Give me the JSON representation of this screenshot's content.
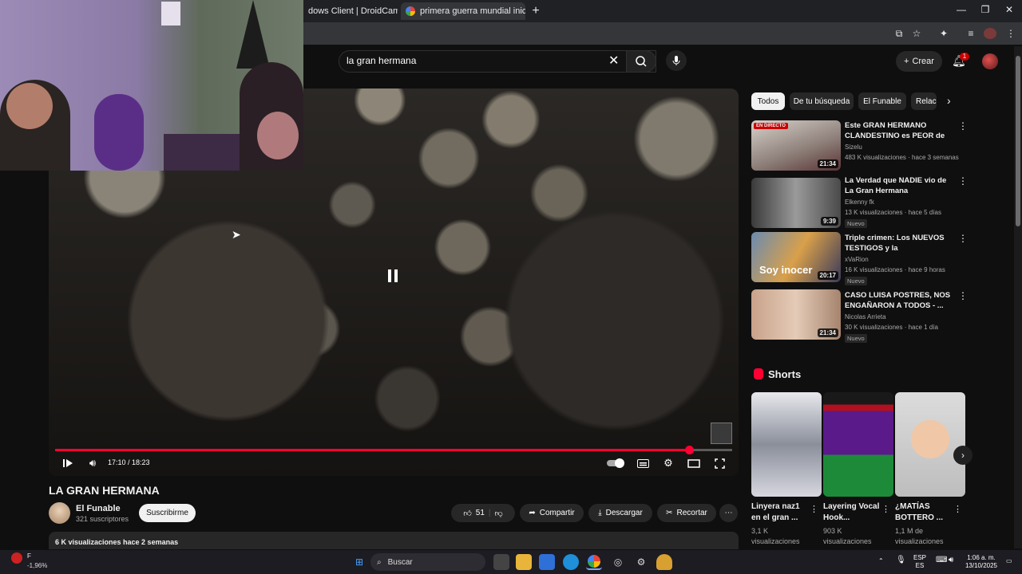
{
  "browser": {
    "tabs": [
      {
        "label": "dows Client | DroidCam"
      },
      {
        "label": "primera guerra mundial inicio ·"
      }
    ],
    "window_controls": {
      "minimize": "—",
      "maximize": "❐",
      "close": "✕"
    }
  },
  "youtube": {
    "search": {
      "query": "la gran hermana"
    },
    "create_label": "Crear",
    "notification_count": "1"
  },
  "player": {
    "time": "17:10 / 18:23",
    "progress_fraction": 0.936,
    "state": "paused"
  },
  "video": {
    "title": "LA GRAN HERMANA",
    "channel": "El Funable",
    "subscribers": "321 suscriptores",
    "subscribe_label": "Suscribirme",
    "likes": "51",
    "share_label": "Compartir",
    "download_label": "Descargar",
    "clip_label": "Recortar",
    "meta": "6 K visualizaciones  hace 2 semanas"
  },
  "chips": [
    "Todos",
    "De tu búsqueda",
    "El Funable",
    "Relaci"
  ],
  "recommendations": [
    {
      "title": "Este GRAN HERMANO CLANDESTINO es PEOR de lo ...",
      "channel": "Sizelu",
      "meta": "483 K visualizaciones · hace 3 semanas",
      "duration": "21:34",
      "live_label": "EN DIRECTO",
      "badge": ""
    },
    {
      "title": "La Verdad que NADIE vio de La Gran Hermana",
      "channel": "Elkenny fk",
      "meta": "13 K visualizaciones · hace 5 días",
      "duration": "9:39",
      "badge": "Nuevo"
    },
    {
      "title": "Triple crimen: Los NUEVOS TESTIGOS y la DECLARACION ...",
      "channel": "xVaRion",
      "meta": "16 K visualizaciones · hace 9 horas",
      "duration": "20:17",
      "badge": "Nuevo",
      "thumb_text": "Soy inocer"
    },
    {
      "title": "CASO LUISA POSTRES, NOS ENGAÑARON A TODOS  - ...",
      "channel": "Nicolas Arrieta",
      "meta": "30 K visualizaciones · hace 1 día",
      "duration": "21:34",
      "badge": "Nuevo"
    }
  ],
  "shorts": {
    "heading": "Shorts",
    "items": [
      {
        "title": "Linyera naz1 en el gran ...",
        "views": "3,1 K",
        "views_label": "visualizaciones"
      },
      {
        "title": "Layering Vocal Hook...",
        "views": "903 K",
        "views_label": "visualizaciones"
      },
      {
        "title": "¿MATÍAS BOTTERO ...",
        "views": "1,1 M de",
        "views_label": "visualizaciones"
      }
    ]
  },
  "taskbar": {
    "search_label": "Buscar",
    "stock": "-1,96%",
    "stock_letter": "F",
    "lang": "ESP",
    "lang2": "ES",
    "time": "1:06 a. m.",
    "date": "13/10/2025"
  },
  "colors": {
    "accent": "#ff0033",
    "background": "#0f0f0f"
  }
}
